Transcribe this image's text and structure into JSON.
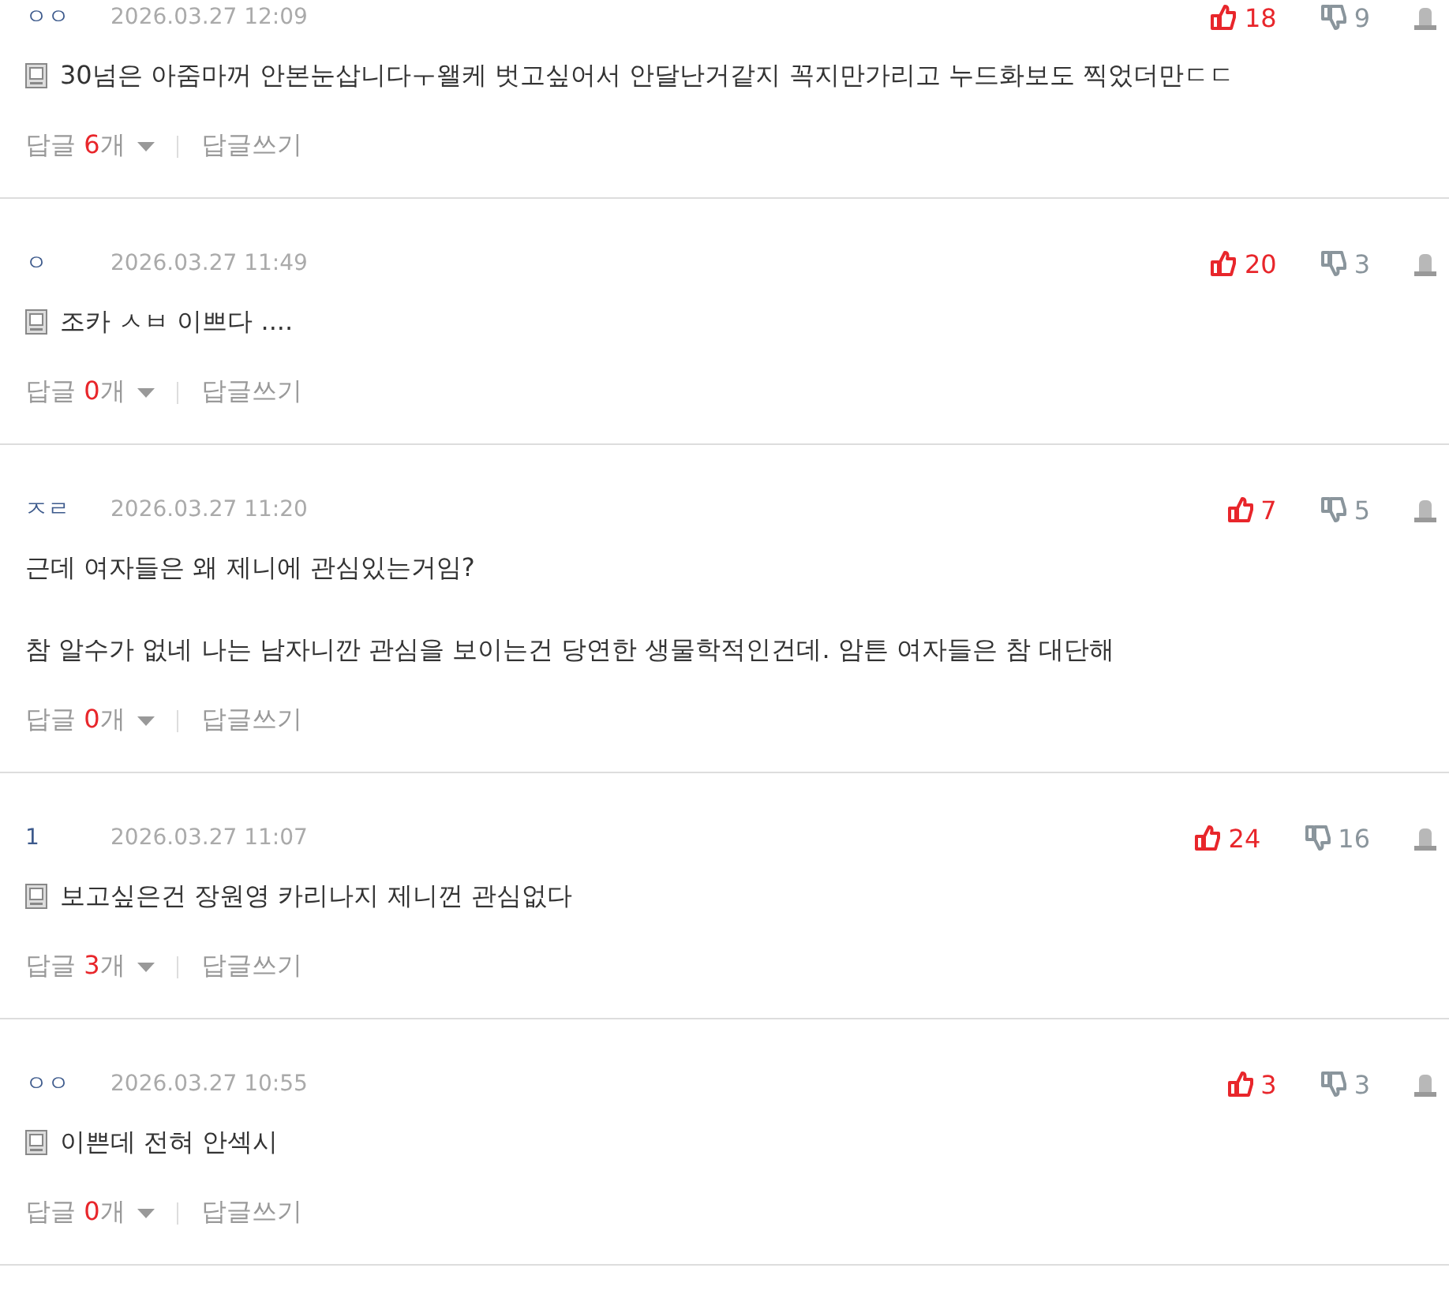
{
  "comments": [
    {
      "author": "ㅇㅇ",
      "date": "2026.03.27 12:09",
      "likes": "18",
      "dislikes": "9",
      "mobile": true,
      "body": [
        "30넘은 아줌마꺼 안본눈삽니다ㅜ왤케 벗고싶어서 안달난거같지 꼭지만가리고 누드화보도 찍었더만ㄷㄷ"
      ],
      "reply_label": "답글",
      "reply_count": "6",
      "reply_unit": "개",
      "write_label": "답글쓰기"
    },
    {
      "author": "ㅇ",
      "date": "2026.03.27 11:49",
      "likes": "20",
      "dislikes": "3",
      "mobile": true,
      "body": [
        "조카 ㅅㅂ 이쁘다 ...."
      ],
      "reply_label": "답글",
      "reply_count": "0",
      "reply_unit": "개",
      "write_label": "답글쓰기"
    },
    {
      "author": "ㅈㄹ",
      "date": "2026.03.27 11:20",
      "likes": "7",
      "dislikes": "5",
      "mobile": false,
      "body": [
        "근데 여자들은 왜 제니에 관심있는거임?",
        "참 알수가 없네 나는 남자니깐 관심을 보이는건 당연한 생물학적인건데. 암튼 여자들은 참 대단해"
      ],
      "reply_label": "답글",
      "reply_count": "0",
      "reply_unit": "개",
      "write_label": "답글쓰기"
    },
    {
      "author": "1",
      "date": "2026.03.27 11:07",
      "likes": "24",
      "dislikes": "16",
      "mobile": true,
      "body": [
        "보고싶은건 장원영 카리나지 제니껀 관심없다"
      ],
      "reply_label": "답글",
      "reply_count": "3",
      "reply_unit": "개",
      "write_label": "답글쓰기"
    },
    {
      "author": "ㅇㅇ",
      "date": "2026.03.27 10:55",
      "likes": "3",
      "dislikes": "3",
      "mobile": true,
      "body": [
        "이쁜데 전혀 안섹시"
      ],
      "reply_label": "답글",
      "reply_count": "0",
      "reply_unit": "개",
      "write_label": "답글쓰기"
    }
  ]
}
